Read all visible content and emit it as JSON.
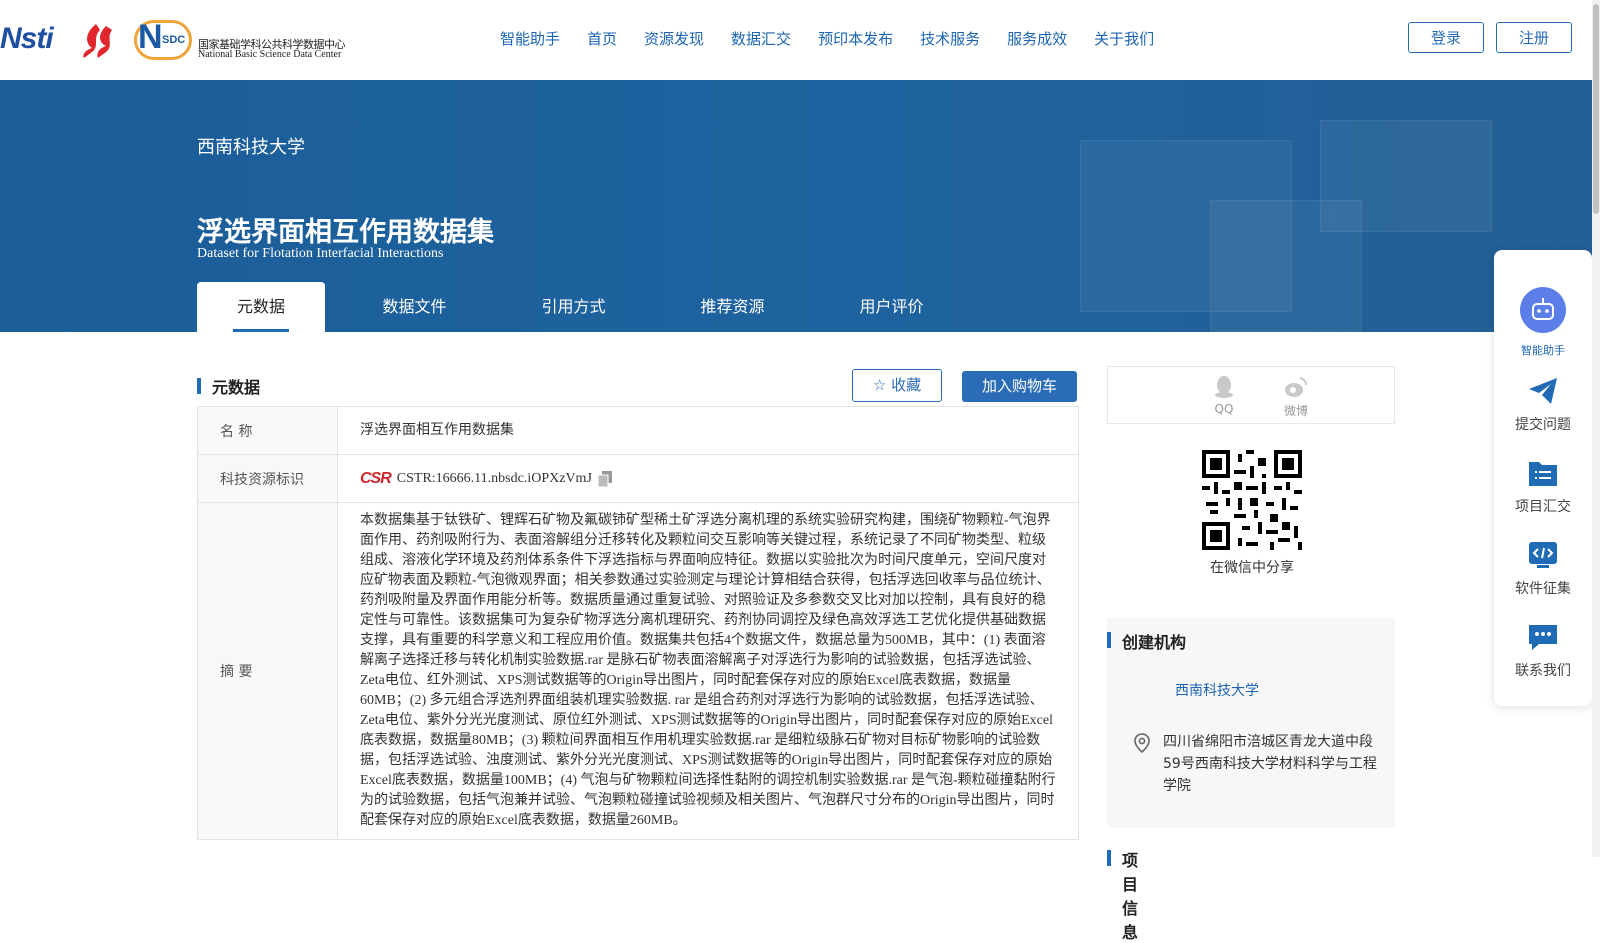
{
  "header": {
    "logos": {
      "nsti": "Nsti",
      "nsdc_letters": "N",
      "nsdc_sub": "SDC",
      "nsdc_cn": "国家基础学科公共科学数据中心",
      "nsdc_en": "National Basic Science Data Center"
    },
    "nav": [
      "智能助手",
      "首页",
      "资源发现",
      "数据汇交",
      "预印本发布",
      "技术服务",
      "服务成效",
      "关于我们"
    ],
    "login": "登录",
    "register": "注册"
  },
  "banner": {
    "institution": "西南科技大学",
    "title": "浮选界面相互作用数据集",
    "title_en": "Dataset for Flotation Interfacial Interactions",
    "tabs": [
      "元数据",
      "数据文件",
      "引用方式",
      "推荐资源",
      "用户评价"
    ],
    "active_tab": "元数据"
  },
  "metadata": {
    "section_title": "元数据",
    "favorite": "☆ 收藏",
    "add_cart": "加入购物车",
    "rows": {
      "name_label": "名  称",
      "name_value": "浮选界面相互作用数据集",
      "id_label": "科技资源标识",
      "id_value": "CSTR:16666.11.nbsdc.iOPXzVmJ",
      "abstract_label": "摘  要",
      "abstract_value": "本数据集基于钛铁矿、锂辉石矿物及氟碳铈矿型稀土矿浮选分离机理的系统实验研究构建，围绕矿物颗粒-气泡界面作用、药剂吸附行为、表面溶解组分迁移转化及颗粒间交互影响等关键过程，系统记录了不同矿物类型、粒级组成、溶液化学环境及药剂体系条件下浮选指标与界面响应特征。数据以实验批次为时间尺度单元，空间尺度对应矿物表面及颗粒-气泡微观界面；相关参数通过实验测定与理论计算相结合获得，包括浮选回收率与品位统计、药剂吸附量及界面作用能分析等。数据质量通过重复试验、对照验证及多参数交叉比对加以控制，具有良好的稳定性与可靠性。该数据集可为复杂矿物浮选分离机理研究、药剂协同调控及绿色高效浮选工艺优化提供基础数据支撑，具有重要的科学意义和工程应用价值。数据集共包括4个数据文件，数据总量为500MB，其中：(1) 表面溶解离子选择迁移与转化机制实验数据.rar 是脉石矿物表面溶解离子对浮选行为影响的试验数据，包括浮选试验、Zeta电位、红外测试、XPS测试数据等的Origin导出图片，同时配套保存对应的原始Excel底表数据，数据量60MB；(2) 多元组合浮选剂界面组装机理实验数据. rar 是组合药剂对浮选行为影响的试验数据，包括浮选试验、Zeta电位、紫外分光光度测试、原位红外测试、XPS测试数据等的Origin导出图片，同时配套保存对应的原始Excel底表数据，数据量80MB；(3) 颗粒间界面相互作用机理实验数据.rar 是细粒级脉石矿物对目标矿物影响的试验数据，包括浮选试验、浊度测试、紫外分光光度测试、XPS测试数据等的Origin导出图片，同时配套保存对应的原始Excel底表数据，数据量100MB；(4) 气泡与矿物颗粒间选择性黏附的调控机制实验数据.rar 是气泡-颗粒碰撞黏附行为的试验数据，包括气泡兼并试验、气泡颗粒碰撞试验视频及相关图片、气泡群尺寸分布的Origin导出图片，同时配套保存对应的原始Excel底表数据，数据量260MB。"
    }
  },
  "sidebar": {
    "share": [
      {
        "label": "QQ",
        "icon": "qq-icon"
      },
      {
        "label": "微博",
        "icon": "weibo-icon"
      }
    ],
    "qr_caption": "在微信中分享",
    "org_title": "创建机构",
    "org_name": "西南科技大学",
    "org_address": "四川省绵阳市涪城区青龙大道中段59号西南科技大学材料科学与工程学院",
    "next_title": "项目信息"
  },
  "float_panel": [
    "智能助手",
    "提交问题",
    "项目汇交",
    "软件征集",
    "联系我们"
  ],
  "colors": {
    "brand": "#1c65b1",
    "banner": "#1e639f",
    "accent": "#2a6cb5"
  }
}
